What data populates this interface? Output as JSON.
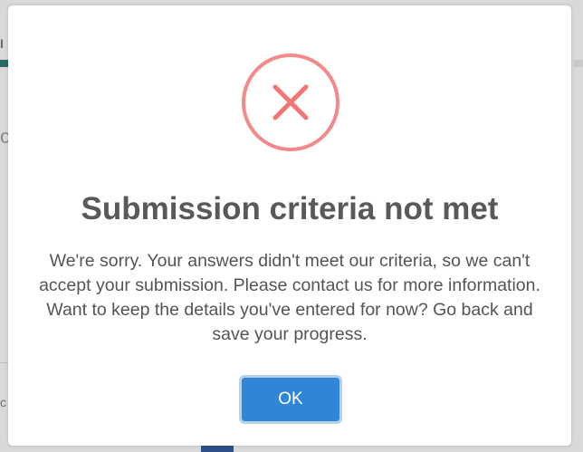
{
  "background": {
    "fragment_1": "I",
    "fragment_2": "c",
    "fragment_3": "c"
  },
  "modal": {
    "icon": "error-x-icon",
    "icon_color": "#f27474",
    "title": "Submission criteria not met",
    "message": "We're sorry. Your answers didn't meet our criteria, so we can't accept your submission. Please contact us for more information. Want to keep the details you've entered for now? Go back and save your progress.",
    "ok_label": "OK",
    "ok_color": "#3085d6"
  }
}
